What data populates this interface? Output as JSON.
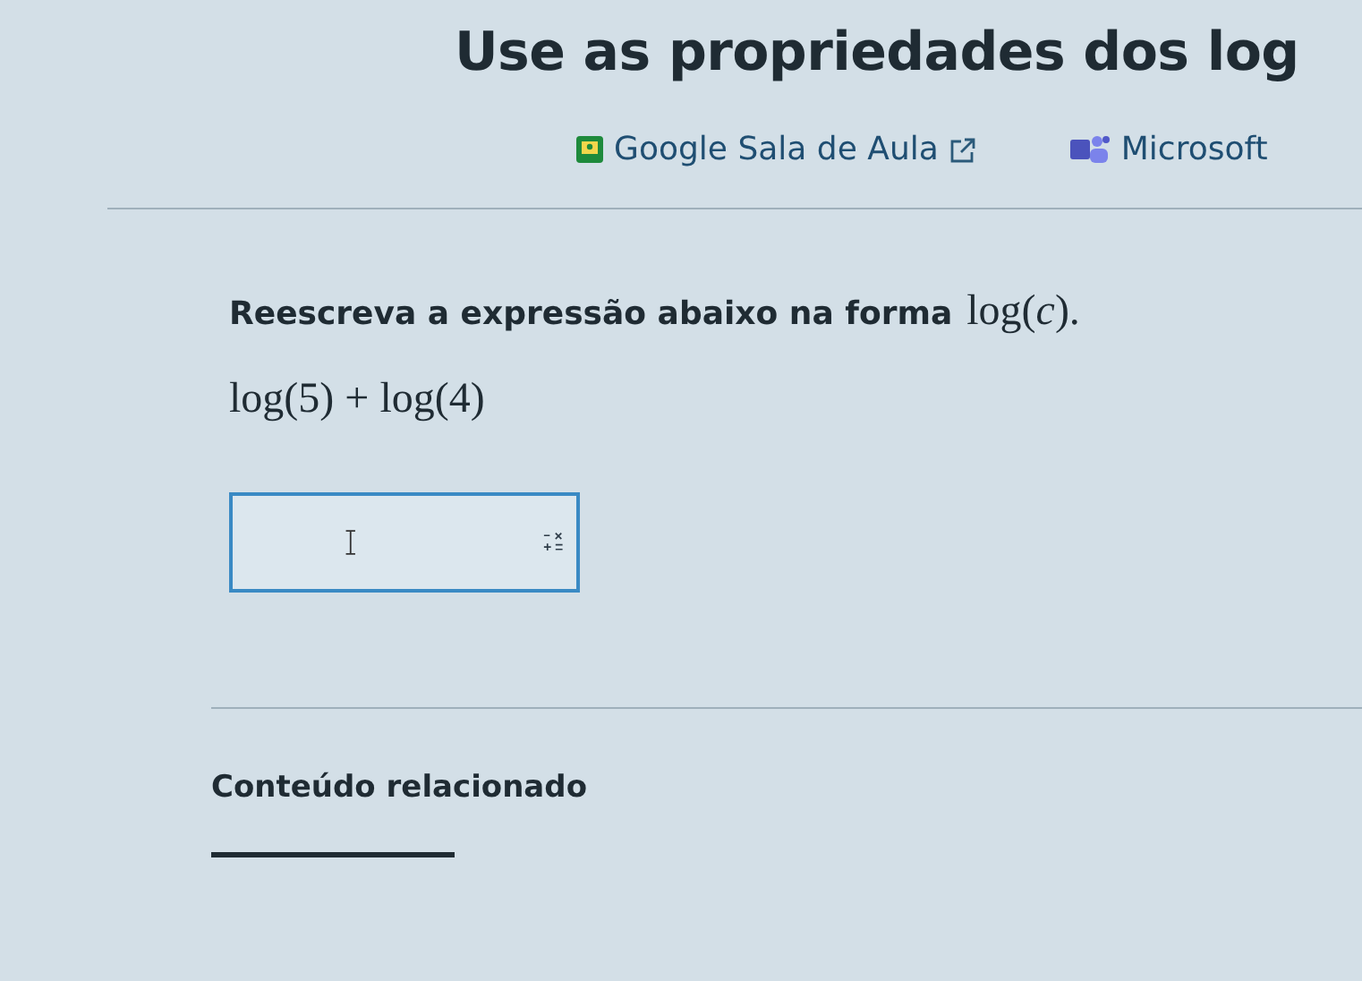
{
  "title": "Use as propriedades dos log",
  "share_links": [
    {
      "kind": "classroom",
      "label": "Google Sala de Aula",
      "external": true
    },
    {
      "kind": "teams",
      "label": "Microsoft",
      "external": false
    }
  ],
  "question": {
    "prompt": "Reescreva a expressão abaixo na forma",
    "prompt_math": "log(*c*).",
    "expression": "log(5) + log(4)"
  },
  "related": {
    "heading": "Conteúdo relacionado"
  }
}
